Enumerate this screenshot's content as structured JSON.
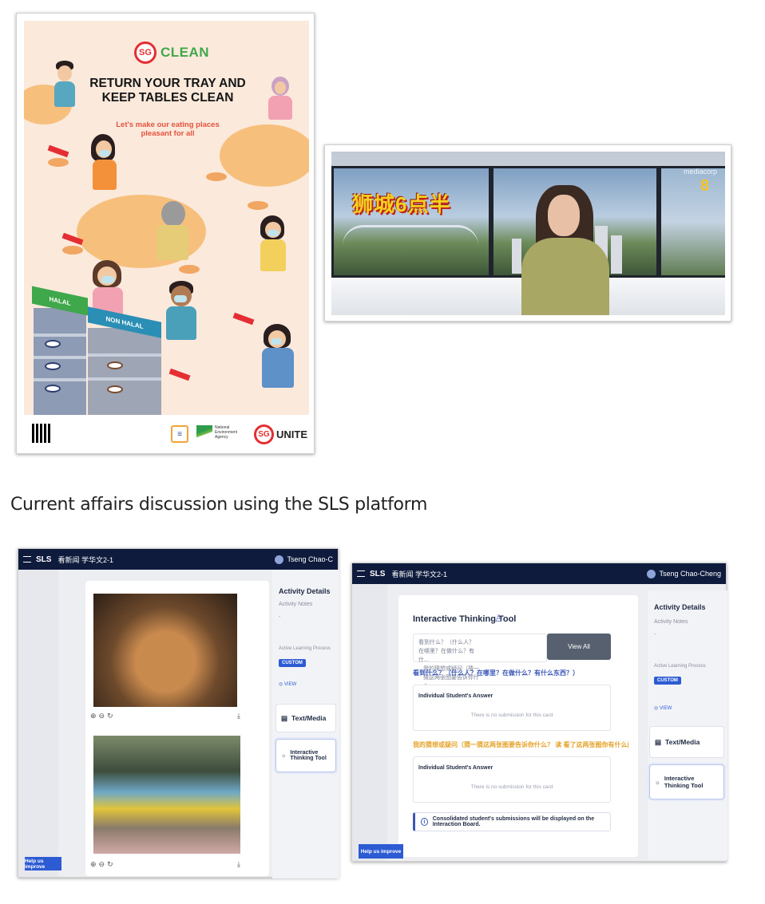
{
  "poster": {
    "logo_sg": "SG",
    "logo_text": "CLEAN",
    "title": "RETURN YOUR TRAY AND KEEP TABLES CLEAN",
    "subtitle": "Let's make our eating places pleasant for all",
    "rack_halal": "HALAL",
    "rack_non_halal": "NON HALAL",
    "agency_text": "National Environment Agency",
    "unite_sg": "SG",
    "unite_text": "UNITE"
  },
  "tv": {
    "show_title": "狮城6点半",
    "channel_brand": "mediacorp",
    "channel_number": "8"
  },
  "caption": "Current affairs discussion using the SLS platform",
  "sls1": {
    "brand": "SLS",
    "crumb": "看新闻 学华文2-1",
    "user": "Tseng Chao-C",
    "activity_details": "Activity Details",
    "activity_notes": "Activity Notes",
    "notes_value": "-",
    "learning_process": "Active Learning Process",
    "badge": "CUSTOM",
    "view": "VIEW",
    "item_text_media": "Text/Media",
    "item_thinking_tool": "Interactive Thinking Tool",
    "help": "Help us improve"
  },
  "sls2": {
    "brand": "SLS",
    "crumb": "看新闻 学华文2-1",
    "user": "Tseng Chao-Cheng",
    "tool_title": "Interactive Thinking Tool",
    "prompt_left": "看到什么？（什么人？在哪里？在做什么？有什...",
    "prompt_right": "我的猜想或疑问（猜一猜这两张图要告诉你什么...",
    "view_all": "View All",
    "question_1": "看到什么？（什么人？在哪里？在做什么？有什么东西？）",
    "answer_heading_1": "Individual Student's Answer",
    "no_submission_1": "There is no submission for this card",
    "question_2": "我的猜想或疑问（猜一猜这两张图要告诉你什么？ 读 看了这两张图你有什么问题想问？）",
    "answer_heading_2": "Individual Student's Answer",
    "no_submission_2": "There is no submission for this card",
    "notice": "Consolidated student's submissions will be displayed on the Interaction Board.",
    "activity_details": "Activity Details",
    "activity_notes": "Activity Notes",
    "notes_value": "-",
    "learning_process": "Active Learning Process",
    "badge": "CUSTOM",
    "view": "VIEW",
    "item_text_media": "Text/Media",
    "item_thinking_tool": "Interactive Thinking Tool",
    "help": "Help us improve"
  },
  "colors": {
    "sg_red": "#e52e34",
    "sg_green": "#3ea84a",
    "sls_navy": "#0f1b3d",
    "sls_blue": "#2d5bd4",
    "question_orange": "#e5a32a"
  }
}
